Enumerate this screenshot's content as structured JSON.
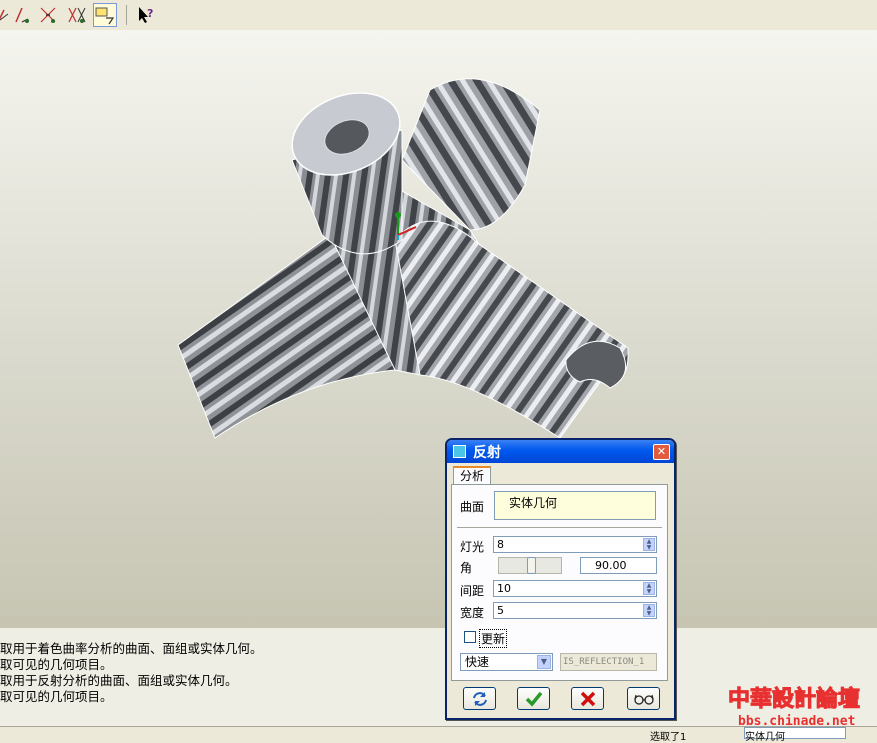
{
  "toolbar": {
    "icons": [
      "curvature-analysis-icon",
      "draft-analysis-icon",
      "section-analysis-icon",
      "offset-analysis-icon",
      "reflection-analysis-icon",
      "context-help-icon"
    ]
  },
  "messages": [
    "取用于着色曲率分析的曲面、面组或实体几何。",
    "取可见的几何项目。",
    "取用于反射分析的曲面、面组或实体几何。",
    "取可见的几何项目。"
  ],
  "statusbar": {
    "selection": "选取了1",
    "filter": "实体几何"
  },
  "dialog": {
    "title": "反射",
    "tab": "分析",
    "surface_label": "曲面",
    "surface_value": "实体几何",
    "light_label": "灯光",
    "light_value": "8",
    "angle_label": "角",
    "angle_value": "90.00",
    "angle_fraction": 0.5,
    "spacing_label": "间距",
    "spacing_value": "10",
    "width_label": "宽度",
    "width_value": "5",
    "update_label": "更新",
    "update_checked": false,
    "mode_value": "快速",
    "name_value": "IS_REFLECTION_1"
  },
  "watermark": {
    "line1": "中華設計論壇",
    "line2": "bbs.chinade.net"
  },
  "colors": {
    "title_bar": "#0058ee",
    "accept_green": "#2a9a2a",
    "cancel_red": "#d01010",
    "watermark_red": "#e83030"
  }
}
